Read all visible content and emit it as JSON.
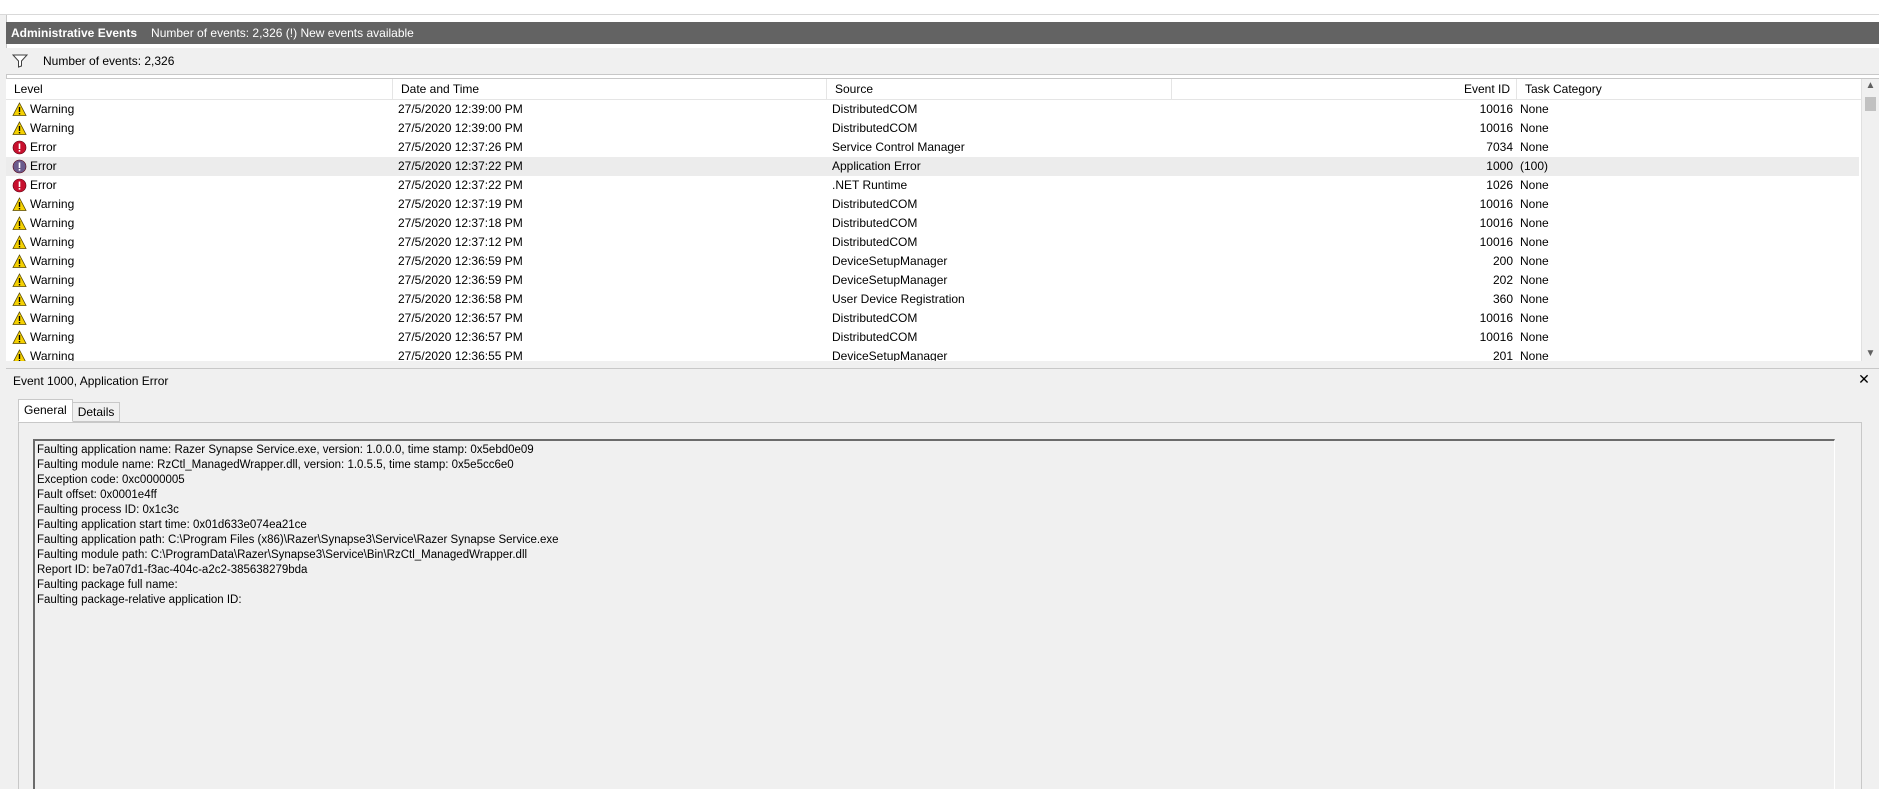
{
  "header": {
    "title": "Administrative Events",
    "subtitle": "Number of events: 2,326 (!) New events available"
  },
  "filter_bar": {
    "label": "Number of events: 2,326",
    "icon": "filter-funnel-icon"
  },
  "table": {
    "columns": [
      "Level",
      "Date and Time",
      "Source",
      "Event ID",
      "Task Category"
    ],
    "rows": [
      {
        "level": "Warning",
        "icon": "warning-icon",
        "date": "27/5/2020 12:39:00 PM",
        "source": "DistributedCOM",
        "event_id": "10016",
        "task": "None"
      },
      {
        "level": "Warning",
        "icon": "warning-icon",
        "date": "27/5/2020 12:39:00 PM",
        "source": "DistributedCOM",
        "event_id": "10016",
        "task": "None"
      },
      {
        "level": "Error",
        "icon": "error-icon",
        "date": "27/5/2020 12:37:26 PM",
        "source": "Service Control Manager",
        "event_id": "7034",
        "task": "None"
      },
      {
        "level": "Error",
        "icon": "error-icon",
        "date": "27/5/2020 12:37:22 PM",
        "source": "Application Error",
        "event_id": "1000",
        "task": "(100)",
        "selected": true
      },
      {
        "level": "Error",
        "icon": "error-icon",
        "date": "27/5/2020 12:37:22 PM",
        "source": ".NET Runtime",
        "event_id": "1026",
        "task": "None"
      },
      {
        "level": "Warning",
        "icon": "warning-icon",
        "date": "27/5/2020 12:37:19 PM",
        "source": "DistributedCOM",
        "event_id": "10016",
        "task": "None"
      },
      {
        "level": "Warning",
        "icon": "warning-icon",
        "date": "27/5/2020 12:37:18 PM",
        "source": "DistributedCOM",
        "event_id": "10016",
        "task": "None"
      },
      {
        "level": "Warning",
        "icon": "warning-icon",
        "date": "27/5/2020 12:37:12 PM",
        "source": "DistributedCOM",
        "event_id": "10016",
        "task": "None"
      },
      {
        "level": "Warning",
        "icon": "warning-icon",
        "date": "27/5/2020 12:36:59 PM",
        "source": "DeviceSetupManager",
        "event_id": "200",
        "task": "None"
      },
      {
        "level": "Warning",
        "icon": "warning-icon",
        "date": "27/5/2020 12:36:59 PM",
        "source": "DeviceSetupManager",
        "event_id": "202",
        "task": "None"
      },
      {
        "level": "Warning",
        "icon": "warning-icon",
        "date": "27/5/2020 12:36:58 PM",
        "source": "User Device Registration",
        "event_id": "360",
        "task": "None"
      },
      {
        "level": "Warning",
        "icon": "warning-icon",
        "date": "27/5/2020 12:36:57 PM",
        "source": "DistributedCOM",
        "event_id": "10016",
        "task": "None"
      },
      {
        "level": "Warning",
        "icon": "warning-icon",
        "date": "27/5/2020 12:36:57 PM",
        "source": "DistributedCOM",
        "event_id": "10016",
        "task": "None"
      },
      {
        "level": "Warning",
        "icon": "warning-icon",
        "date": "27/5/2020 12:36:55 PM",
        "source": "DeviceSetupManager",
        "event_id": "201",
        "task": "None"
      }
    ]
  },
  "detail": {
    "title": "Event 1000, Application Error",
    "close_icon": "close-icon",
    "tabs": [
      "General",
      "Details"
    ],
    "active_tab": "General",
    "description_lines": [
      "Faulting application name: Razer Synapse Service.exe, version: 1.0.0.0, time stamp: 0x5ebd0e09",
      "Faulting module name: RzCtl_ManagedWrapper.dll, version: 1.0.5.5, time stamp: 0x5e5cc6e0",
      "Exception code: 0xc0000005",
      "Fault offset: 0x0001e4ff",
      "Faulting process ID: 0x1c3c",
      "Faulting application start time: 0x01d633e074ea21ce",
      "Faulting application path: C:\\Program Files (x86)\\Razer\\Synapse3\\Service\\Razer Synapse Service.exe",
      "Faulting module path: C:\\ProgramData\\Razer\\Synapse3\\Service\\Bin\\RzCtl_ManagedWrapper.dll",
      "Report ID: be7a07d1-f3ac-404c-a2c2-385638279bda",
      "Faulting package full name:",
      "Faulting package-relative application ID:"
    ]
  },
  "colors": {
    "header_bg": "#636363",
    "pane_bg": "#f0f0f0",
    "warning": "#f5d100",
    "error": "#c8102e",
    "error_selected": "#6b5b8c",
    "selected_row": "#ececec"
  }
}
